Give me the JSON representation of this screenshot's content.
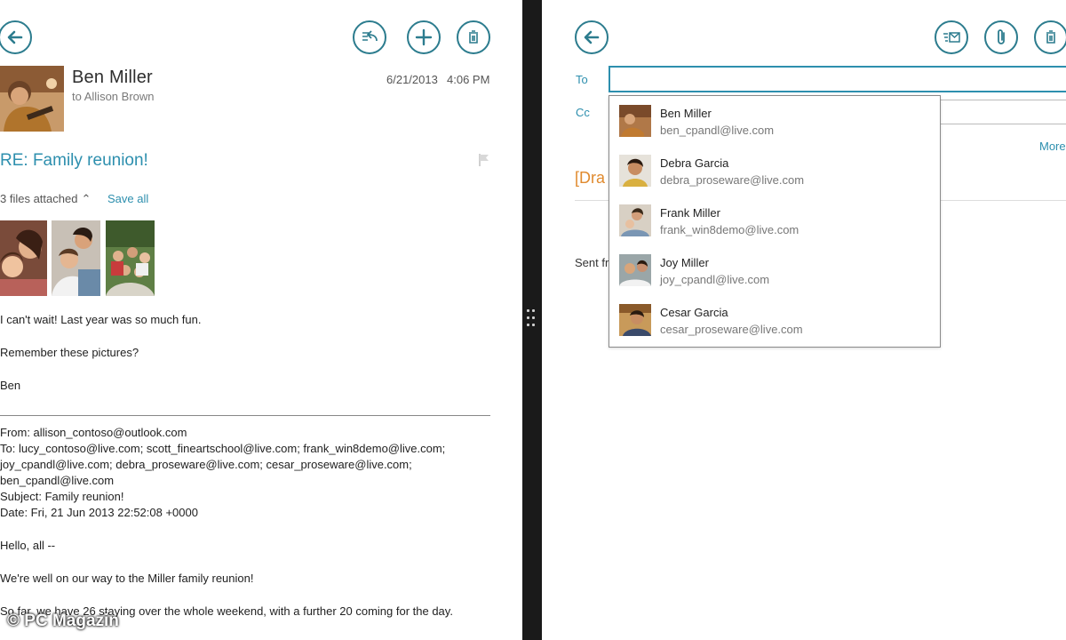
{
  "message": {
    "sender": "Ben Miller",
    "recipient_line": "to Allison Brown",
    "date": "6/21/2013",
    "time": "4:06 PM",
    "subject": "RE: Family reunion!",
    "attachments_label": "3 files attached",
    "save_all": "Save all",
    "body": [
      "I can't wait! Last year was so much fun.",
      "Remember these pictures?",
      "Ben"
    ],
    "quoted": {
      "from": "From: allison_contoso@outlook.com",
      "to_lines": [
        "To: lucy_contoso@live.com; scott_fineartschool@live.com; frank_win8demo@live.com;",
        "joy_cpandl@live.com; debra_proseware@live.com; cesar_proseware@live.com;",
        "ben_cpandl@live.com"
      ],
      "subject": "Subject: Family reunion!",
      "date": "Date: Fri, 21 Jun 2013 22:52:08 +0000",
      "greeting": "Hello, all --",
      "line1": "We're well on our way to the Miller family reunion!",
      "line2": "So far, we have 26 staying over the whole weekend, with a further 20 coming for the day."
    }
  },
  "left_toolbar": {
    "icons": [
      "back-icon",
      "reply-icon",
      "new-icon",
      "delete-icon"
    ]
  },
  "compose": {
    "to_label": "To",
    "cc_label": "Cc",
    "to_value": "",
    "more": "More",
    "draft_title": "[Dra",
    "sent_from": "Sent fr",
    "icons": [
      "back-icon",
      "send-icon",
      "attach-icon",
      "delete-icon"
    ]
  },
  "suggestions": [
    {
      "name": "Ben Miller",
      "email": "ben_cpandl@live.com"
    },
    {
      "name": "Debra Garcia",
      "email": "debra_proseware@live.com"
    },
    {
      "name": "Frank Miller",
      "email": "frank_win8demo@live.com"
    },
    {
      "name": "Joy Miller",
      "email": "joy_cpandl@live.com"
    },
    {
      "name": "Cesar Garcia",
      "email": "cesar_proseware@live.com"
    }
  ],
  "watermark": "© PC Magazin",
  "colors": {
    "accent": "#2d8fae",
    "button_ring": "#2c7c8e",
    "draft": "#e08a2e",
    "divider": "#1a1a1a"
  }
}
